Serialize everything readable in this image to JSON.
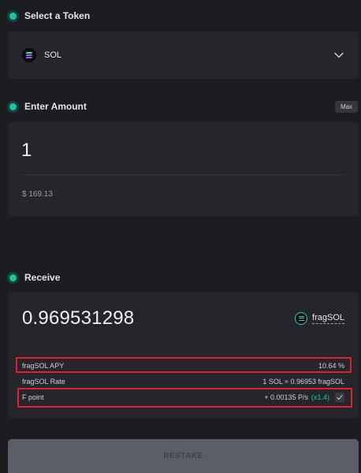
{
  "select_token": {
    "label": "Select a Token",
    "token": "SOL",
    "icon": "sol-token-icon"
  },
  "enter_amount": {
    "label": "Enter Amount",
    "max_label": "Max",
    "value": "1",
    "usd_value": "$ 169.13"
  },
  "receive": {
    "label": "Receive",
    "value": "0.969531298",
    "token": "fragSOL",
    "icon": "fragsol-token-icon",
    "rows": {
      "apy": {
        "label": "fragSOL APY",
        "value": "10.64 %"
      },
      "rate": {
        "label": "fragSOL Rate",
        "value": "1 SOL ≈ 0.96953 fragSOL"
      },
      "point": {
        "label": "F point",
        "value": "+ 0.00135 P/s",
        "multiplier": "(x1.4)"
      }
    }
  },
  "restake_button": "RESTAKE",
  "colors": {
    "accent": "#19c6a6",
    "background": "#1c1d21",
    "card": "#25262b",
    "highlight": "#e0202a",
    "button": "#5b5e68"
  }
}
